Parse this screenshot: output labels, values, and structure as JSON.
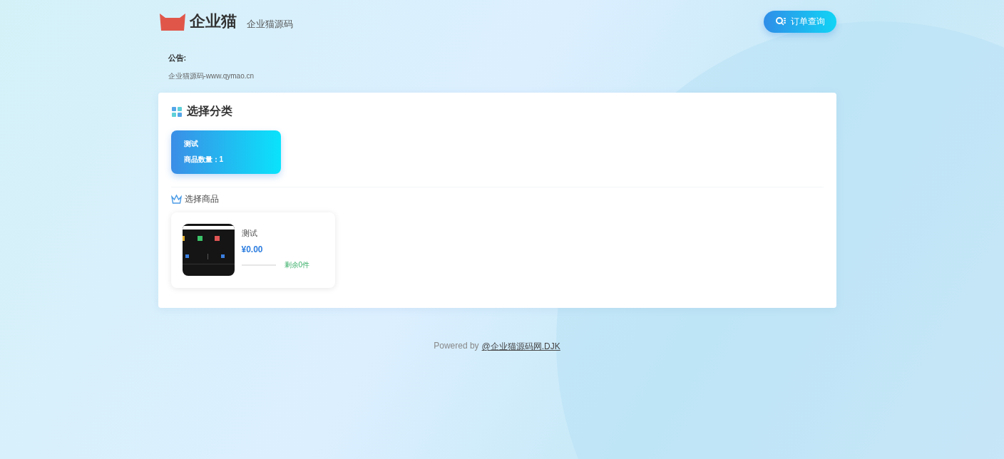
{
  "header": {
    "logo_text": "企业猫",
    "subtitle": "企业猫源码",
    "order_button": "订单查询"
  },
  "notice": {
    "label": "公告:",
    "text": "企业猫源码-www.qymao.cn"
  },
  "category_section": {
    "title": "选择分类",
    "categories": [
      {
        "name": "测试",
        "count_text": "商品数量：1",
        "selected": true
      }
    ]
  },
  "product_section": {
    "title": "选择商品",
    "products": [
      {
        "name": "测试",
        "price": "¥0.00",
        "stock": "剩余0件"
      }
    ]
  },
  "footer": {
    "prefix": "Powered by",
    "link": "@企业猫源码网.DJK"
  }
}
